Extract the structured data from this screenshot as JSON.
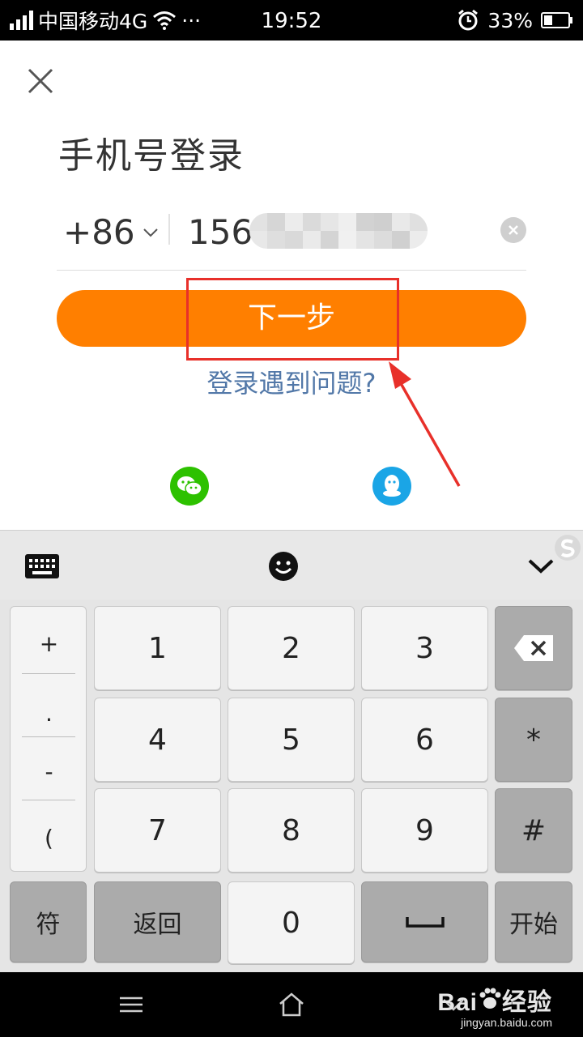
{
  "status_bar": {
    "carrier": "中国移动4G",
    "more": "···",
    "time": "19:52",
    "battery": "33%"
  },
  "login": {
    "title": "手机号登录",
    "country_code": "+86",
    "phone_visible": "156",
    "next_label": "下一步",
    "help_label": "登录遇到问题?"
  },
  "social": {
    "icons": [
      "wechat-icon",
      "qq-icon"
    ],
    "wechat_color": "#2dc100",
    "qq_color": "#1aa5e6"
  },
  "keyboard": {
    "side_keys": [
      "+",
      ".",
      "-",
      "("
    ],
    "digits": [
      "1",
      "2",
      "3",
      "4",
      "5",
      "6",
      "7",
      "8",
      "9",
      "0"
    ],
    "star": "*",
    "hash": "#",
    "symbol_label": "符",
    "back_label": "返回",
    "start_label": "开始",
    "toolbar_icons": [
      "keyboard-icon",
      "emoji-icon",
      "chevron-down-icon"
    ]
  },
  "watermark": {
    "brand": "Bai",
    "brand2": "经验",
    "url": "jingyan.baidu.com"
  },
  "colors": {
    "accent": "#ff7f00",
    "link": "#5278a8",
    "annotation": "#e8302a"
  }
}
